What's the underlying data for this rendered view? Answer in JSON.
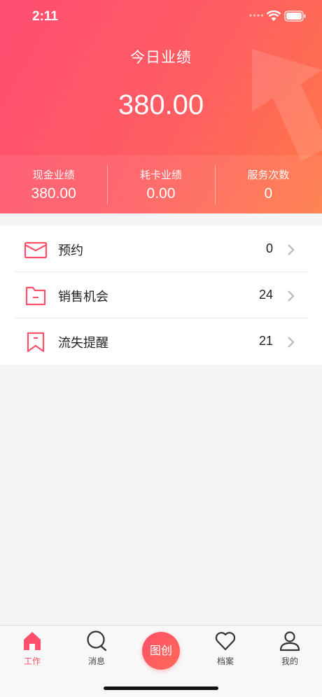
{
  "status_bar": {
    "time": "2:11"
  },
  "hero": {
    "title": "今日业绩",
    "amount": "380.00",
    "stats": [
      {
        "label": "现金业绩",
        "value": "380.00"
      },
      {
        "label": "耗卡业绩",
        "value": "0.00"
      },
      {
        "label": "服务次数",
        "value": "0"
      }
    ]
  },
  "menu": [
    {
      "label": "预约",
      "count": "0",
      "icon": "envelope-icon"
    },
    {
      "label": "销售机会",
      "count": "24",
      "icon": "folder-icon"
    },
    {
      "label": "流失提醒",
      "count": "21",
      "icon": "bookmark-icon"
    }
  ],
  "tabbar": {
    "tabs": [
      {
        "label": "工作",
        "icon": "home-icon",
        "active": true
      },
      {
        "label": "消息",
        "icon": "chat-icon"
      },
      {
        "label": "档案",
        "icon": "heart-icon"
      },
      {
        "label": "我的",
        "icon": "user-icon"
      }
    ],
    "center_label": "图创"
  },
  "colors": {
    "accent": "#ff4f6a",
    "gradient_end": "#ff7a45"
  }
}
